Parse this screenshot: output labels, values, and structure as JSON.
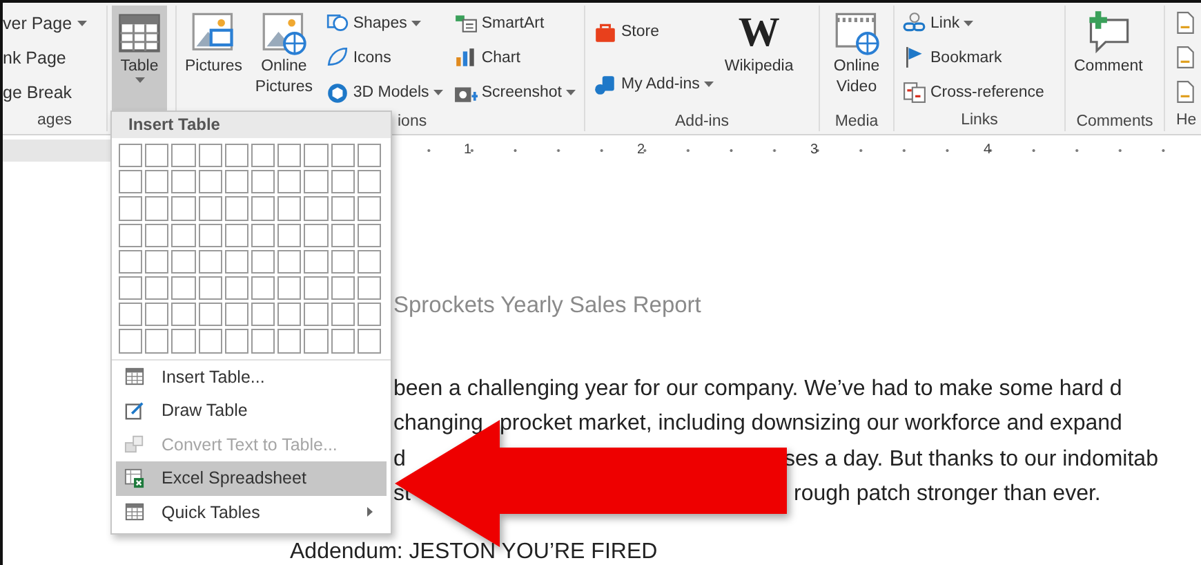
{
  "ribbon": {
    "groups": [
      {
        "label": "ages",
        "items": [
          {
            "kind": "text",
            "label": "ver Page",
            "dropdown": true,
            "pressed": false
          },
          {
            "kind": "text",
            "label": "nk Page",
            "dropdown": false,
            "pressed": false
          },
          {
            "kind": "text",
            "label": "ge Break",
            "dropdown": false,
            "pressed": false
          }
        ]
      },
      {
        "items": [
          {
            "kind": "large",
            "label": "Table",
            "dropdown": true,
            "pressed": true
          }
        ]
      },
      {
        "label": "ions",
        "items": [
          {
            "kind": "large",
            "label": "Pictures",
            "dropdown": false,
            "pressed": false
          },
          {
            "kind": "large",
            "label": "Online Pictures",
            "dropdown": false,
            "pressed": false
          },
          {
            "kind": "small",
            "label": "Shapes",
            "dropdown": true,
            "pressed": false
          },
          {
            "kind": "small",
            "label": "Icons",
            "dropdown": false,
            "pressed": false
          },
          {
            "kind": "small",
            "label": "3D Models",
            "dropdown": true,
            "pressed": false
          },
          {
            "kind": "small",
            "label": "SmartArt",
            "dropdown": false,
            "pressed": false
          },
          {
            "kind": "small",
            "label": "Chart",
            "dropdown": false,
            "pressed": false
          },
          {
            "kind": "small",
            "label": "Screenshot",
            "dropdown": true,
            "pressed": false
          }
        ]
      },
      {
        "label": "Add-ins",
        "items": [
          {
            "kind": "small",
            "label": "Store",
            "dropdown": false,
            "pressed": false
          },
          {
            "kind": "small",
            "label": "My Add-ins",
            "dropdown": true,
            "pressed": false
          },
          {
            "kind": "logo",
            "logo_text": "W",
            "label": "Wikipedia",
            "dropdown": false,
            "pressed": false
          }
        ]
      },
      {
        "label": "Media",
        "items": [
          {
            "kind": "large",
            "label": "Online Video",
            "dropdown": false,
            "pressed": false
          }
        ]
      },
      {
        "label": "Links",
        "items": [
          {
            "kind": "small",
            "label": "Link",
            "dropdown": true,
            "pressed": false
          },
          {
            "kind": "small",
            "label": "Bookmark",
            "dropdown": false,
            "pressed": false
          },
          {
            "kind": "small",
            "label": "Cross-reference",
            "dropdown": false,
            "pressed": false
          }
        ]
      },
      {
        "label": "Comments",
        "items": [
          {
            "kind": "large",
            "label": "Comment",
            "dropdown": false,
            "pressed": false
          }
        ]
      },
      {
        "label": "He",
        "items": [
          {
            "kind": "icon",
            "dropdown": false,
            "pressed": false
          },
          {
            "kind": "icon",
            "dropdown": false,
            "pressed": false
          },
          {
            "kind": "icon",
            "dropdown": false,
            "pressed": false
          }
        ]
      }
    ]
  },
  "ruler": {
    "numbers": [
      "1",
      "2",
      "3",
      "4"
    ]
  },
  "document": {
    "title": "Sprockets Yearly Sales Report",
    "lines": [
      {
        "segments": [
          "been a challenging year for our company. We’ve had to make some hard d"
        ]
      },
      {
        "segments": [
          "changing",
          "procket market, including downsizing our workforce and expand"
        ]
      },
      {
        "segments": [
          "d",
          "ses a day. But thanks to our indomitab"
        ]
      },
      {
        "segments": [
          "st",
          "rough patch stronger than ever."
        ]
      }
    ],
    "addendum": "Addendum: JESTON YOU’RE FIRED"
  },
  "table_menu": {
    "title": "Insert Table",
    "items": [
      {
        "label": "Insert Table...",
        "disabled": false,
        "selected": false,
        "submenu": false
      },
      {
        "label": "Draw Table",
        "disabled": false,
        "selected": false,
        "submenu": false
      },
      {
        "label": "Convert Text to Table...",
        "disabled": true,
        "selected": false,
        "submenu": false
      },
      {
        "label": "Excel Spreadsheet",
        "disabled": false,
        "selected": true,
        "submenu": false
      },
      {
        "label": "Quick Tables",
        "disabled": false,
        "selected": false,
        "submenu": true
      }
    ]
  }
}
